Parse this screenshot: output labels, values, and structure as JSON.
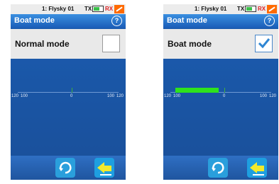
{
  "screens": [
    {
      "status": {
        "model": "1: Flysky 01",
        "tx": "TX",
        "rx": "RX"
      },
      "title": "Boat mode",
      "help_label": "?",
      "mode_label": "Normal mode",
      "checked": false,
      "ticks": {
        "left_outer": "120",
        "left_inner": "100",
        "center": "0",
        "right_inner": "100",
        "right_outer": "120"
      }
    },
    {
      "status": {
        "model": "1: Flysky 01",
        "tx": "TX",
        "rx": "RX"
      },
      "title": "Boat mode",
      "help_label": "?",
      "mode_label": "Boat mode",
      "checked": true,
      "ticks": {
        "left_outer": "120",
        "left_inner": "100",
        "center": "0",
        "right_inner": "100",
        "right_outer": "120"
      }
    }
  ],
  "colors": {
    "accent": "#1b5eb9",
    "throttle_bar": "#2ee31c",
    "rx_warning": "#e02020"
  },
  "icons": [
    "help-icon",
    "battery-icon",
    "rx-alert-icon",
    "reverse-icon",
    "back-icon",
    "checkmark-icon"
  ]
}
